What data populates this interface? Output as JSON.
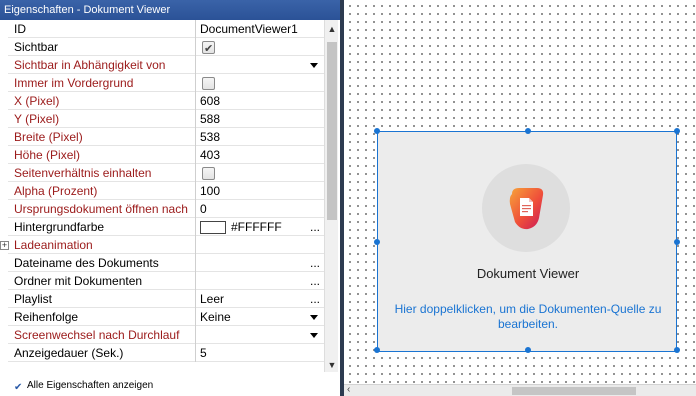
{
  "panel": {
    "title": "Eigenschaften - Dokument Viewer",
    "show_all_label": "Alle Eigenschaften anzeigen"
  },
  "properties": [
    {
      "name": "ID",
      "value": "DocumentViewer1",
      "kind": "text",
      "red": false
    },
    {
      "name": "Sichtbar",
      "value": "",
      "kind": "checkbox",
      "checked": true,
      "red": false
    },
    {
      "name": "Sichtbar in Abhängigkeit von",
      "value": "",
      "kind": "dropdown",
      "red": true
    },
    {
      "name": "Immer im Vordergrund",
      "value": "",
      "kind": "checkbox",
      "checked": false,
      "red": true
    },
    {
      "name": "X (Pixel)",
      "value": "608",
      "kind": "text",
      "red": true
    },
    {
      "name": "Y (Pixel)",
      "value": "588",
      "kind": "text",
      "red": true
    },
    {
      "name": "Breite (Pixel)",
      "value": "538",
      "kind": "text",
      "red": true
    },
    {
      "name": "Höhe (Pixel)",
      "value": "403",
      "kind": "text",
      "red": true
    },
    {
      "name": "Seitenverhältnis einhalten",
      "value": "",
      "kind": "checkbox",
      "checked": false,
      "red": true
    },
    {
      "name": "Alpha (Prozent)",
      "value": "100",
      "kind": "text",
      "red": true
    },
    {
      "name": "Ursprungsdokument öffnen nach",
      "value": "0",
      "kind": "text",
      "red": true
    },
    {
      "name": "Hintergrundfarbe",
      "value": "#FFFFFF",
      "kind": "color",
      "red": false
    },
    {
      "name": "Ladeanimation",
      "value": "",
      "kind": "group",
      "red": true
    },
    {
      "name": "Dateiname des Dokuments",
      "value": "",
      "kind": "dots",
      "red": false
    },
    {
      "name": "Ordner mit Dokumenten",
      "value": "",
      "kind": "dots",
      "red": false
    },
    {
      "name": "Playlist",
      "value": "Leer",
      "kind": "dots",
      "red": false
    },
    {
      "name": "Reihenfolge",
      "value": "Keine",
      "kind": "dropdown",
      "red": false
    },
    {
      "name": "Screenwechsel nach Durchlauf",
      "value": "",
      "kind": "dropdown",
      "red": true
    },
    {
      "name": "Anzeigedauer (Sek.)",
      "value": "5",
      "kind": "text",
      "red": false
    }
  ],
  "widget": {
    "title": "Dokument Viewer",
    "hint": "Hier doppelklicken, um die Dokumenten-Quelle zu bearbeiten."
  },
  "colors": {
    "title_bar": "#2b5297",
    "label_red": "#9b1a1a",
    "accent_blue": "#1a74d2"
  }
}
